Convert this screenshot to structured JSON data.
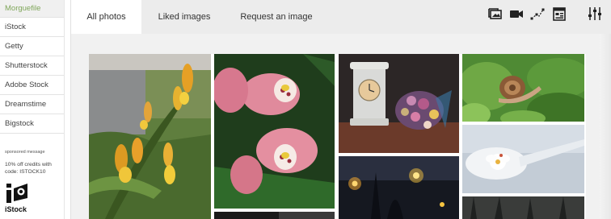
{
  "sidebar": {
    "items": [
      {
        "label": "Morguefile",
        "active": true
      },
      {
        "label": "iStock",
        "active": false
      },
      {
        "label": "Getty",
        "active": false
      },
      {
        "label": "Shutterstock",
        "active": false
      },
      {
        "label": "Adobe Stock",
        "active": false
      },
      {
        "label": "Dreamstime",
        "active": false
      },
      {
        "label": "Bigstock",
        "active": false
      }
    ],
    "sponsored": {
      "label": "sponsored message",
      "text": "10% off credits with code: ISTOCK10",
      "brand": "iStock"
    }
  },
  "tabs": [
    {
      "label": "All photos",
      "active": true
    },
    {
      "label": "Liked images",
      "active": false
    },
    {
      "label": "Request an image",
      "active": false
    }
  ],
  "toolbar": {
    "icons": [
      "photos-icon",
      "video-icon",
      "vector-icon",
      "layout-icon",
      "filters-icon"
    ]
  },
  "colors": {
    "accent": "#7fa65a",
    "tabbar": "#ececec"
  },
  "photos": [
    {
      "name": "photo-yellow-flowers",
      "subject": "yellow-flowers"
    },
    {
      "name": "photo-pink-orchids",
      "subject": "pink-orchids"
    },
    {
      "name": "photo-clock-bouquet",
      "subject": "clock-bouquet"
    },
    {
      "name": "photo-snail-leaves",
      "subject": "snail-leaves"
    },
    {
      "name": "photo-flower-spoon",
      "subject": "flower-spoon"
    },
    {
      "name": "photo-night-lights",
      "subject": "night-lights"
    },
    {
      "name": "photo-dark-trees",
      "subject": "dark-trees"
    },
    {
      "name": "photo-strip-bottom",
      "subject": "strip"
    }
  ]
}
